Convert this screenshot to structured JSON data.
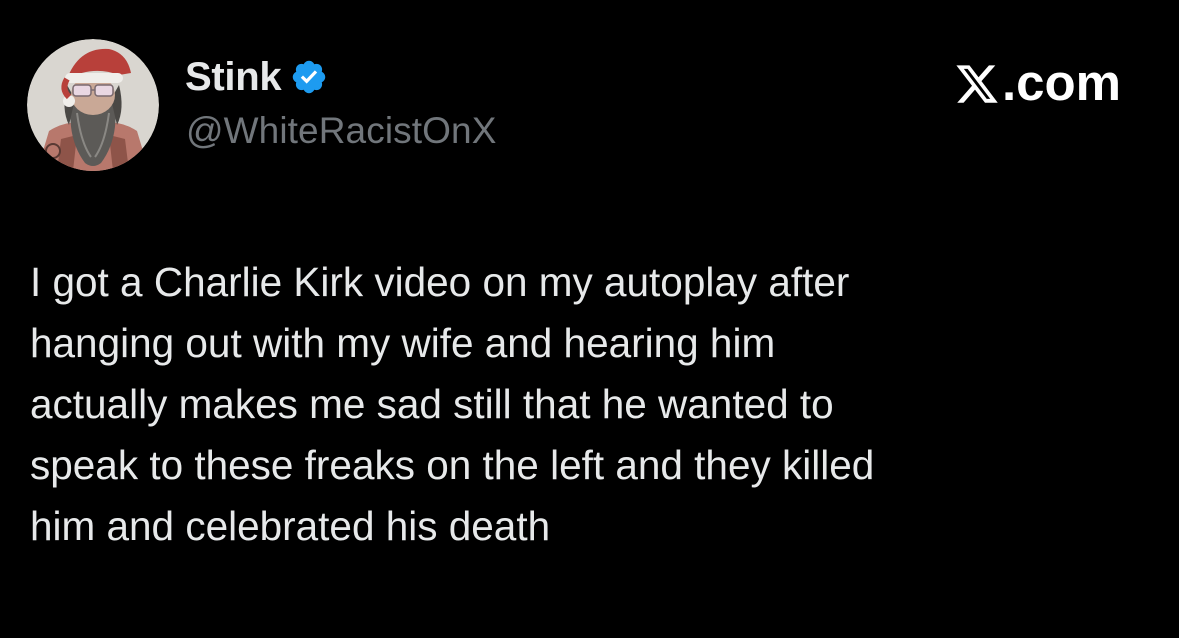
{
  "author": {
    "display_name": "Stink",
    "handle": "@WhiteRacistOnX",
    "verified": true,
    "verified_color": "#1d9bf0",
    "avatar_icon": "santa-hat-bearded-man-avatar"
  },
  "site": {
    "label": ".com",
    "logo_icon": "x-logo-icon"
  },
  "tweet": {
    "lines": [
      "I got a Charlie Kirk video on my autoplay after",
      "hanging out with my wife and hearing him",
      "actually makes me sad still that he wanted to",
      "speak to these freaks on the left and they killed",
      "him and celebrated his death"
    ]
  },
  "colors": {
    "background": "#000000",
    "text_primary": "#e7e9ea",
    "text_secondary": "#71767b"
  }
}
